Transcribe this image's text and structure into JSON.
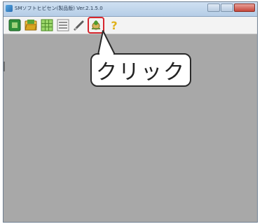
{
  "window": {
    "title": "SMソフトヒビセン(製品版) Ver.2.1.5.0"
  },
  "toolbar": {
    "buttons": [
      {
        "name": "green-square-icon",
        "color": "#2f8f3a"
      },
      {
        "name": "folder-open-icon",
        "color": "#d9a520"
      },
      {
        "name": "grid-icon",
        "color": "#6cbf3a"
      },
      {
        "name": "list-icon",
        "color": "#8a8a8a"
      },
      {
        "name": "pencil-icon",
        "color": "#6f6f6f"
      },
      {
        "name": "plant-gear-icon",
        "color": "#5c9a3a"
      },
      {
        "name": "help-icon",
        "color": "#e0b21c"
      }
    ],
    "highlight_color": "#d7262e"
  },
  "callout": {
    "text": "クリック"
  }
}
